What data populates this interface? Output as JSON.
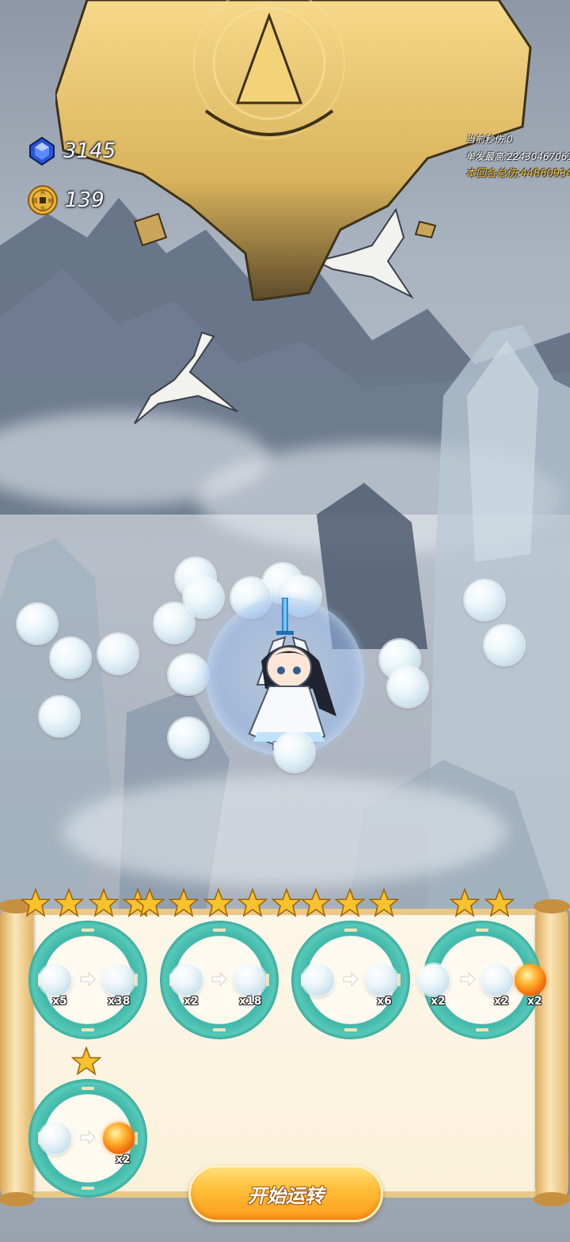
{
  "hud": {
    "gems": "3145",
    "coins": "139",
    "coin_glyphs": [
      "天",
      "地",
      "方",
      "圆"
    ]
  },
  "damage_stats": {
    "current_dps": "当前秒伤:0",
    "single_max": "单发最高:22430467061 2.18",
    "round_total": "本回合总伤:44860934"
  },
  "recipes": [
    {
      "input_count": "x5",
      "output_count": "x38",
      "output_type": "pearl",
      "stars": 6
    },
    {
      "input_count": "x2",
      "output_count": "x18",
      "output_type": "pearl",
      "stars": 6
    },
    {
      "input_count": "",
      "output_count": "x6",
      "output_type": "pearl",
      "stars": 0
    },
    {
      "input_count": "x2",
      "output_count": "x2",
      "output_type": "pearl+fire",
      "extra_count": "x2",
      "stars": 2
    },
    {
      "input_count": "",
      "output_count": "x2",
      "output_type": "fire",
      "stars": 1
    }
  ],
  "start_button": {
    "label": "开始运转"
  },
  "colors": {
    "ring_teal": "#3fb7a9",
    "gold": "#f6c12b",
    "button_orange": "#ff9c1c",
    "scroll_paper": "#fdf7e8"
  }
}
